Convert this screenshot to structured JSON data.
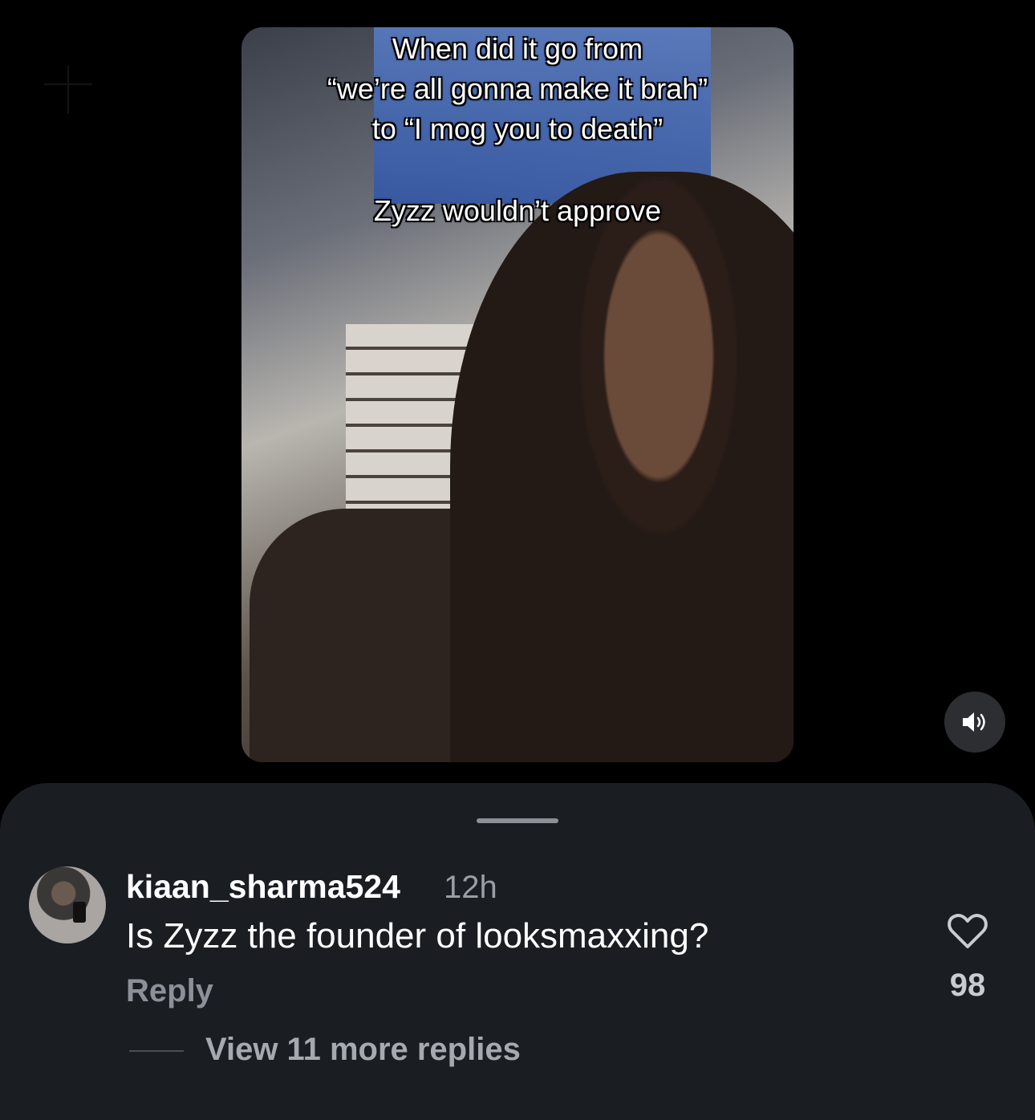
{
  "video": {
    "caption_top": "When did it go from \n“we’re all gonna make it brah” \nto “I mog you to death”",
    "caption_bottom": "Zyzz wouldn’t approve",
    "mute_icon": "speaker-icon"
  },
  "comment": {
    "username": "kiaan_sharma524",
    "time": "12h",
    "text": "Is Zyzz the founder of looksmaxxing?",
    "reply_label": "Reply",
    "like_count": "98",
    "view_replies": "View 11 more replies"
  },
  "colors": {
    "background": "#000000",
    "sheet": "#1a1d22",
    "muted_text": "#8c9098"
  }
}
